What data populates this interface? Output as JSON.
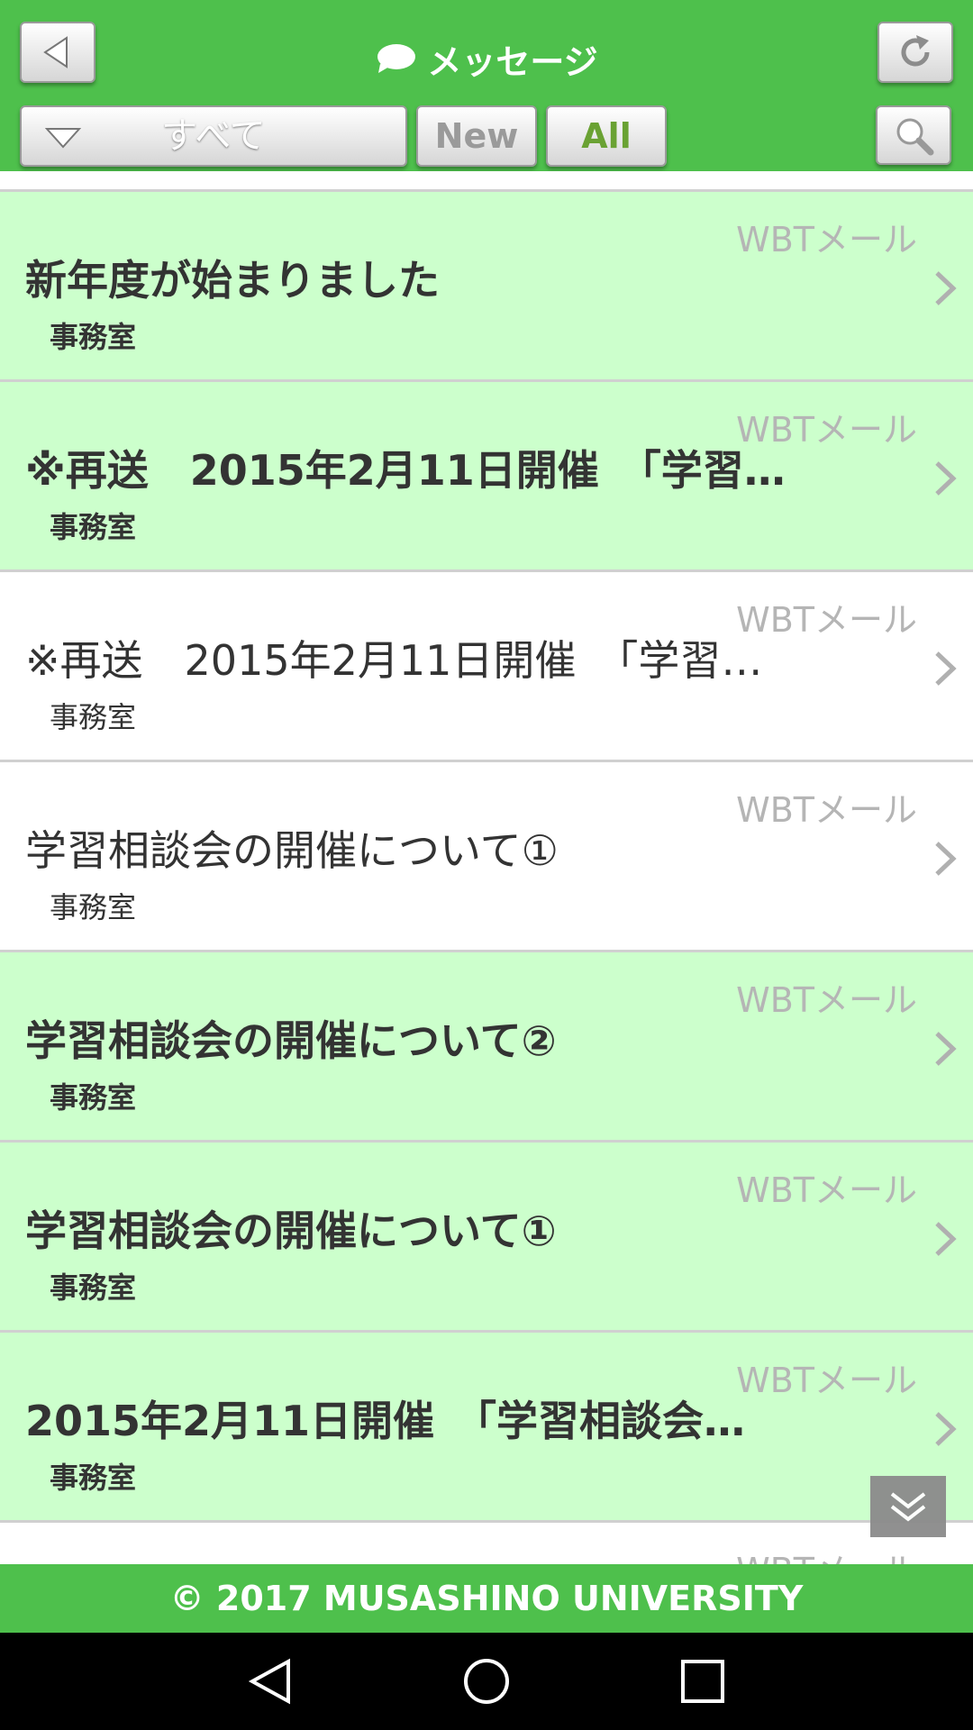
{
  "header": {
    "title": "メッセージ",
    "filter_label": "すべて",
    "new_label": "New",
    "all_label": "All"
  },
  "messages": [
    {
      "source": "WBTメール",
      "subject": "新年度が始まりました",
      "sender": "事務室",
      "unread": true
    },
    {
      "source": "WBTメール",
      "subject": "※再送　2015年2月11日開催　「学習…",
      "sender": "事務室",
      "unread": true
    },
    {
      "source": "WBTメール",
      "subject": "※再送　2015年2月11日開催　「学習…",
      "sender": "事務室",
      "unread": false
    },
    {
      "source": "WBTメール",
      "subject": "学習相談会の開催について①",
      "sender": "事務室",
      "unread": false
    },
    {
      "source": "WBTメール",
      "subject": "学習相談会の開催について②",
      "sender": "事務室",
      "unread": true
    },
    {
      "source": "WBTメール",
      "subject": "学習相談会の開催について①",
      "sender": "事務室",
      "unread": true
    },
    {
      "source": "WBTメール",
      "subject": "2015年2月11日開催　「学習相談会…",
      "sender": "事務室",
      "unread": true
    },
    {
      "source": "WBTメール",
      "subject": "",
      "sender": "",
      "unread": false
    }
  ],
  "footer": {
    "copyright": "© 2017 MUSASHINO UNIVERSITY"
  },
  "colors": {
    "header": "#4ec04c",
    "unread_row": "#ccffcc",
    "read_row": "#ffffff"
  }
}
